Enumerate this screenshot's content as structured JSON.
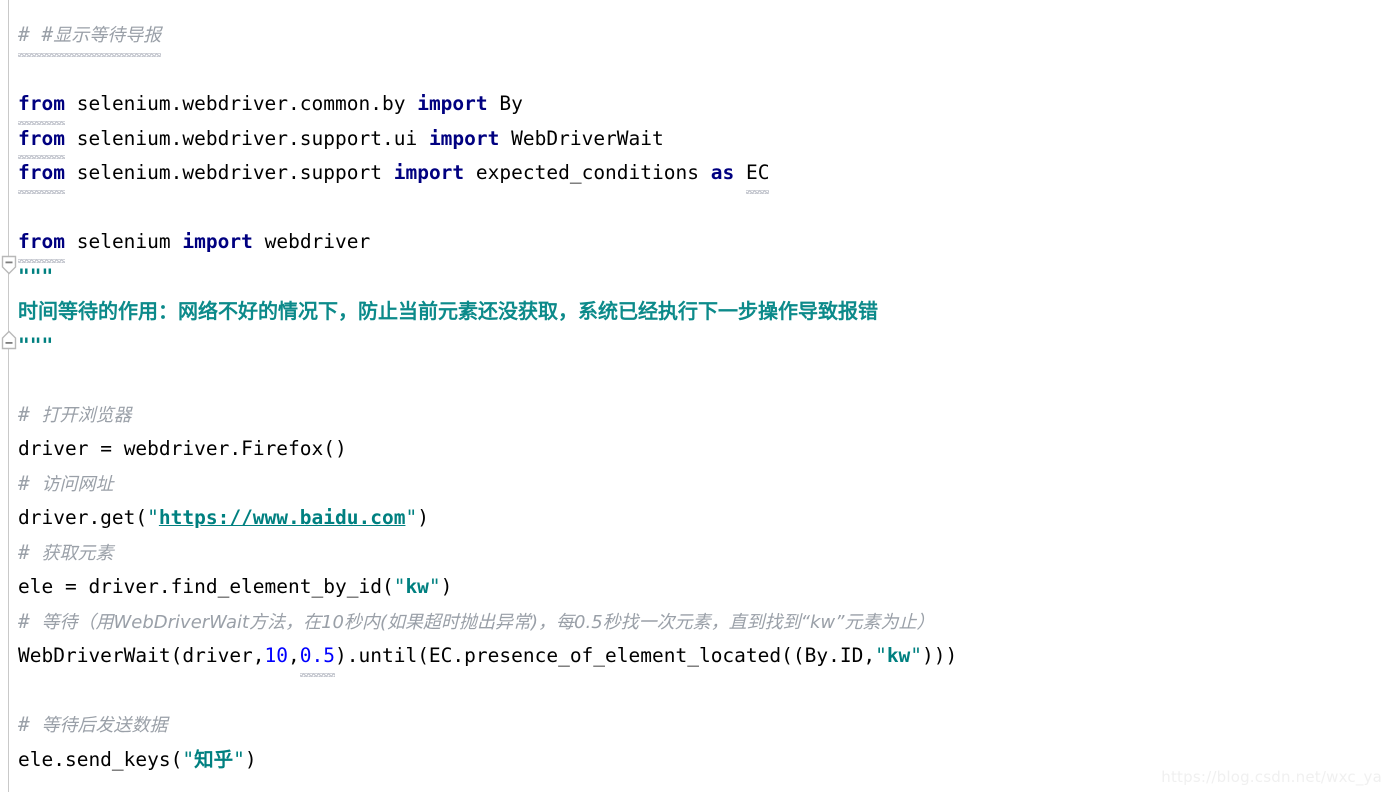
{
  "editor": {
    "language": "Python",
    "background_color": "#ffffff",
    "gutter_line_color": "#c9c9c9",
    "colors": {
      "keyword": "#000080",
      "string": "#008080",
      "number": "#0000ff",
      "comment": "#9aa0a8",
      "docstring": "#0c8a8a",
      "plain_text": "#000000",
      "spellcheck_squiggle": "#c0c4cc"
    }
  },
  "code": {
    "line1": {
      "hash": "# #",
      "comment": "显示等待导报"
    },
    "line3": {
      "kw_from": "from",
      "module": "selenium.webdriver.common.by",
      "kw_import": "import",
      "name": "By"
    },
    "line4": {
      "kw_from": "from",
      "module": "selenium.webdriver.support.ui",
      "kw_import": "import",
      "name": "WebDriverWait"
    },
    "line5": {
      "kw_from": "from",
      "module": "selenium.webdriver.support",
      "kw_import": "import",
      "name": "expected_conditions",
      "kw_as": "as",
      "alias": "EC"
    },
    "line7": {
      "kw_from": "from",
      "module": "selenium",
      "kw_import": "import",
      "name": "webdriver"
    },
    "line8": {
      "quotes": "\"\"\""
    },
    "line9": {
      "text": "时间等待的作用：网络不好的情况下，防止当前元素还没获取，系统已经执行下一步操作导致报错"
    },
    "line10": {
      "quotes": "\"\"\""
    },
    "line12": {
      "hash": "#",
      "comment": "打开浏览器"
    },
    "line13": {
      "target": "driver",
      "equals": " = ",
      "call": "webdriver.Firefox()"
    },
    "line14": {
      "hash": "#",
      "comment": "访问网址"
    },
    "line15": {
      "prefix": "driver.get(",
      "quote_open": "\"",
      "url": "https://www.baidu.com",
      "quote_close": "\"",
      "suffix": ")"
    },
    "line16": {
      "hash": "#",
      "comment": "获取元素"
    },
    "line17": {
      "prefix": "ele = driver.find_element_by_id(",
      "quote_open": "\"",
      "arg": "kw",
      "quote_close": "\"",
      "suffix": ")"
    },
    "line18": {
      "hash": "#",
      "comment": "等待（用WebDriverWait方法，在10秒内(如果超时抛出异常)，每0.5秒找一次元素，直到找到“kw”元素为止）"
    },
    "line19": {
      "part1": "WebDriverWait(driver,",
      "num1": "10",
      "comma": ",",
      "num2": "0.5",
      "part2": ").until(EC.presence_of_element_located((By.ID,",
      "quote_open": "\"",
      "arg": "kw",
      "quote_close": "\"",
      "suffix": ")))"
    },
    "line21": {
      "hash": "#",
      "comment": "等待后发送数据"
    },
    "line22": {
      "prefix": "ele.send_keys(",
      "quote_open": "\"",
      "arg": "知乎",
      "quote_close": "\"",
      "suffix": ")"
    }
  },
  "fold_markers": [
    {
      "name": "fold-docstring-start",
      "state": "expanded",
      "symbol": "−",
      "direction": "down"
    },
    {
      "name": "fold-docstring-end",
      "state": "expanded",
      "symbol": "−",
      "direction": "up"
    }
  ],
  "watermark": {
    "text": "https://blog.csdn.net/wxc_ya"
  }
}
